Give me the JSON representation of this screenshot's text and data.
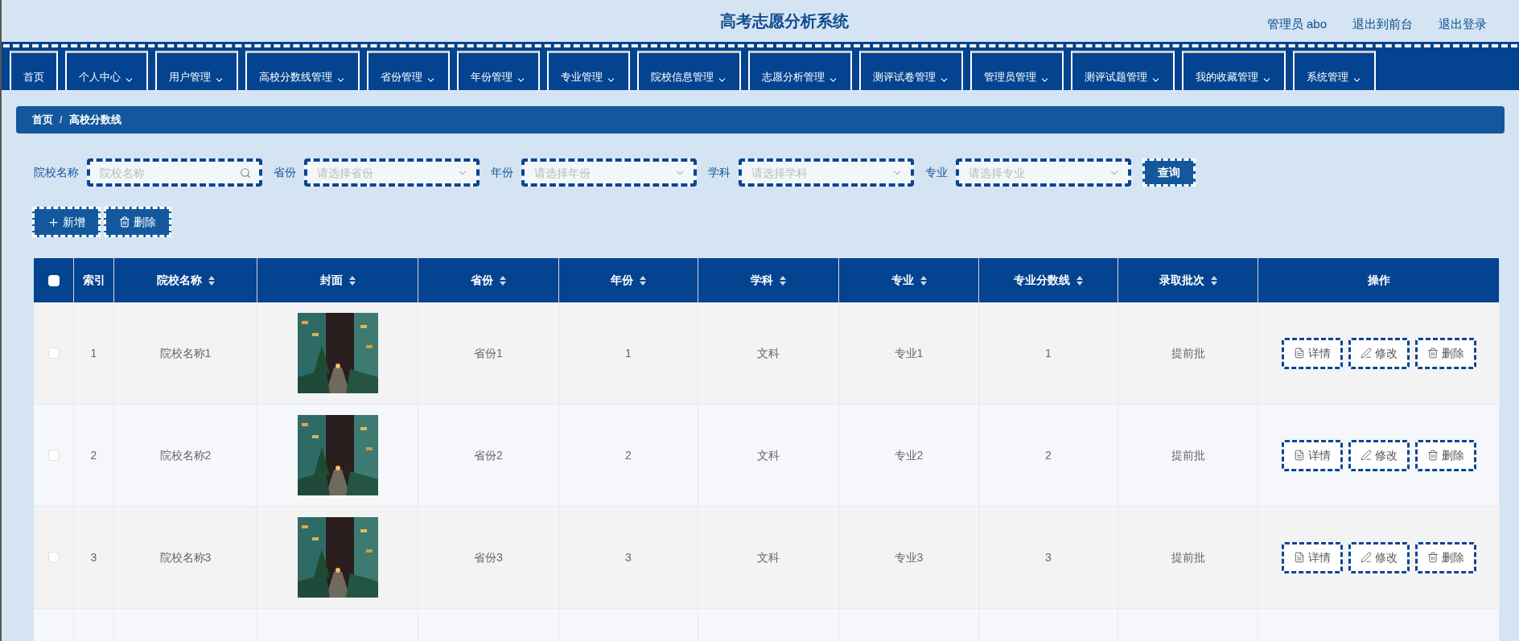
{
  "header": {
    "title": "高考志愿分析系统",
    "links": [
      "管理员 abo",
      "退出到前台",
      "退出登录"
    ]
  },
  "nav": [
    {
      "label": "首页",
      "has_menu": false
    },
    {
      "label": "个人中心",
      "has_menu": true
    },
    {
      "label": "用户管理",
      "has_menu": true
    },
    {
      "label": "高校分数线管理",
      "has_menu": true
    },
    {
      "label": "省份管理",
      "has_menu": true
    },
    {
      "label": "年份管理",
      "has_menu": true
    },
    {
      "label": "专业管理",
      "has_menu": true
    },
    {
      "label": "院校信息管理",
      "has_menu": true
    },
    {
      "label": "志愿分析管理",
      "has_menu": true
    },
    {
      "label": "测评试卷管理",
      "has_menu": true
    },
    {
      "label": "管理员管理",
      "has_menu": true
    },
    {
      "label": "测评试题管理",
      "has_menu": true
    },
    {
      "label": "我的收藏管理",
      "has_menu": true
    },
    {
      "label": "系统管理",
      "has_menu": true
    }
  ],
  "breadcrumb": [
    "首页",
    "高校分数线"
  ],
  "breadcrumb_separator": "/",
  "filters": [
    {
      "label": "院校名称",
      "placeholder": "院校名称",
      "kind": "search"
    },
    {
      "label": "省份",
      "placeholder": "请选择省份",
      "kind": "select"
    },
    {
      "label": "年份",
      "placeholder": "请选择年份",
      "kind": "select"
    },
    {
      "label": "学科",
      "placeholder": "请选择学科",
      "kind": "select"
    },
    {
      "label": "专业",
      "placeholder": "请选择专业",
      "kind": "select"
    }
  ],
  "search_button": "查询",
  "actions": [
    {
      "label": "新增",
      "kind": "add"
    },
    {
      "label": "删除",
      "kind": "delete"
    }
  ],
  "table": {
    "select_all": {
      "checked": false
    },
    "columns": [
      {
        "label": "索引",
        "sortable": false
      },
      {
        "label": "院校名称",
        "sortable": true
      },
      {
        "label": "封面",
        "sortable": true
      },
      {
        "label": "省份",
        "sortable": true
      },
      {
        "label": "年份",
        "sortable": true
      },
      {
        "label": "学科",
        "sortable": true
      },
      {
        "label": "专业",
        "sortable": true
      },
      {
        "label": "专业分数线",
        "sortable": true
      },
      {
        "label": "录取批次",
        "sortable": true
      },
      {
        "label": "操作",
        "sortable": false
      }
    ],
    "rows": [
      {
        "checked": false,
        "index": "1",
        "name": "院校名称1",
        "province": "省份1",
        "year": "1",
        "subject": "文科",
        "major": "专业1",
        "score": "1",
        "batch": "提前批",
        "buttons": [
          {
            "label": "详情",
            "kind": "detail"
          },
          {
            "label": "修改",
            "kind": "edit"
          },
          {
            "label": "删除",
            "kind": "delete"
          }
        ]
      },
      {
        "checked": false,
        "index": "2",
        "name": "院校名称2",
        "province": "省份2",
        "year": "2",
        "subject": "文科",
        "major": "专业2",
        "score": "2",
        "batch": "提前批",
        "buttons": [
          {
            "label": "详情",
            "kind": "detail"
          },
          {
            "label": "修改",
            "kind": "edit"
          },
          {
            "label": "删除",
            "kind": "delete"
          }
        ]
      },
      {
        "checked": false,
        "index": "3",
        "name": "院校名称3",
        "province": "省份3",
        "year": "3",
        "subject": "文科",
        "major": "专业3",
        "score": "3",
        "batch": "提前批",
        "buttons": [
          {
            "label": "详情",
            "kind": "detail"
          },
          {
            "label": "修改",
            "kind": "edit"
          },
          {
            "label": "删除",
            "kind": "delete"
          }
        ]
      }
    ]
  }
}
